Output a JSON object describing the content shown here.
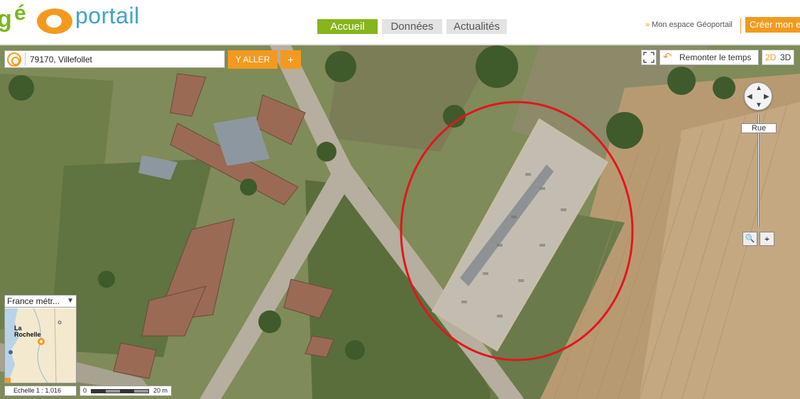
{
  "logo": {
    "part1": "g",
    "part2": "é",
    "part3": "portail"
  },
  "nav": {
    "tabs": [
      {
        "label": "Accueil",
        "active": true
      },
      {
        "label": "Données",
        "active": false
      },
      {
        "label": "Actualités",
        "active": false
      }
    ]
  },
  "header": {
    "espace_link": "Mon espace Géoportail",
    "espace_arrow": "»",
    "create_button": "Créer mon e"
  },
  "search": {
    "value": "79170, Villefollet",
    "go_label": "Y ALLER",
    "plus_label": "+"
  },
  "map_controls": {
    "time_button": "Remonter le temps",
    "mode_2d": "2D",
    "mode_3d": "3D",
    "zoom_level_label": "Rue"
  },
  "overview": {
    "select_value": "France métr...",
    "city_label_1": "La",
    "city_label_2": "Rochelle"
  },
  "scale": {
    "ratio": "Echelle 1 :  1.016",
    "bar_start": "0",
    "bar_end": "20 m"
  },
  "colors": {
    "accent_orange": "#f39a1e",
    "accent_green": "#86b51d",
    "highlight_circle": "#e2161c"
  }
}
